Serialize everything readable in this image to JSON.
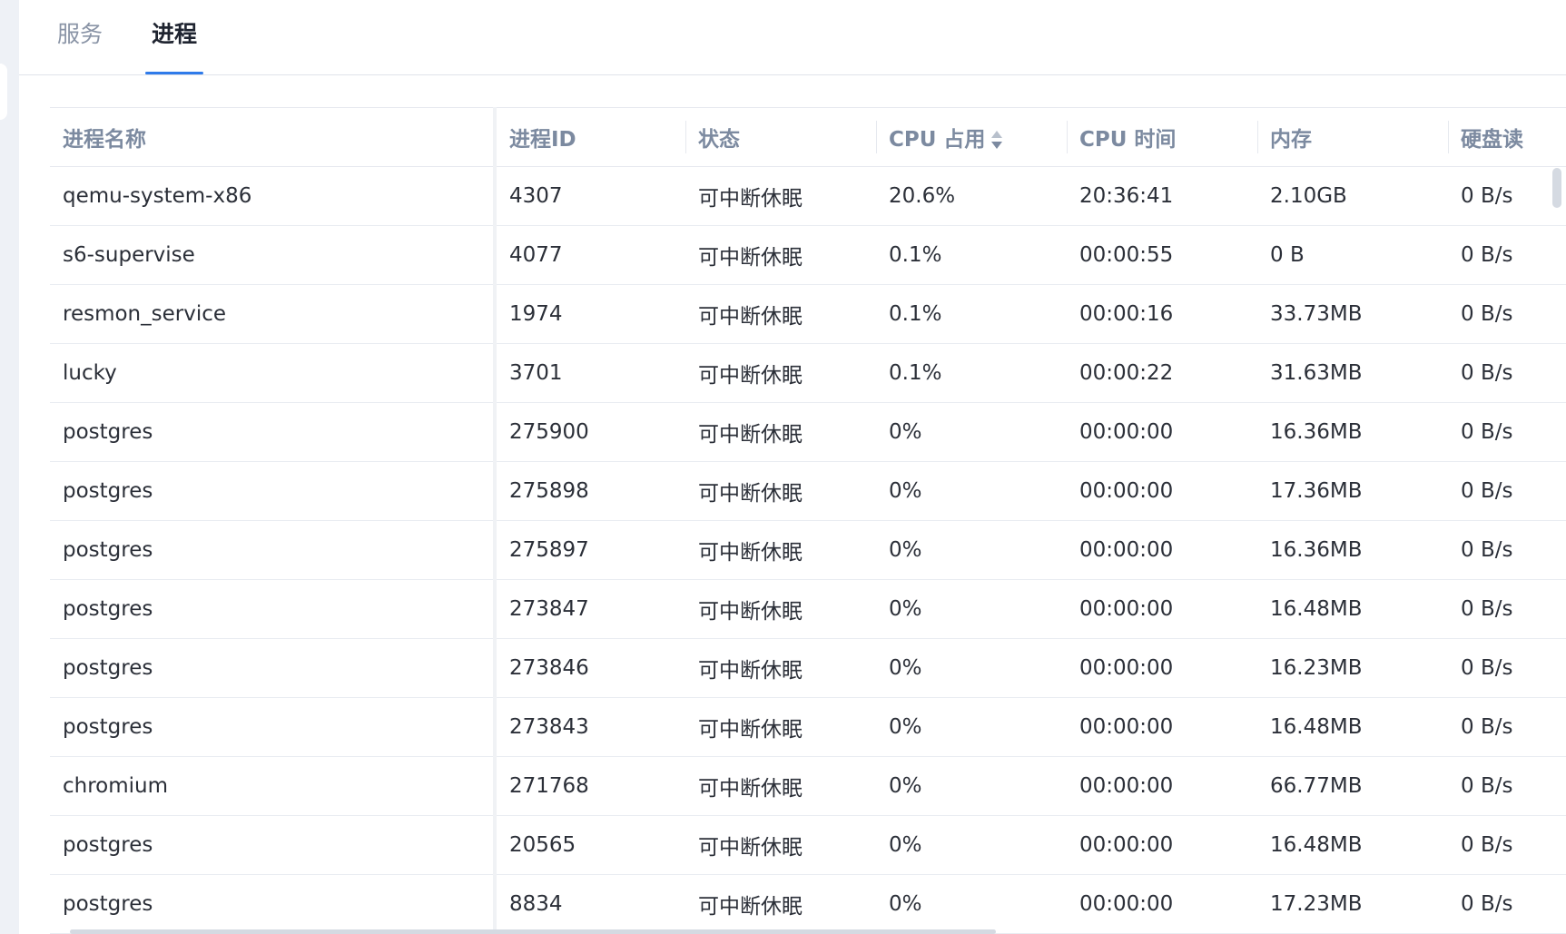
{
  "tabs": [
    {
      "label": "服务",
      "active": false
    },
    {
      "label": "进程",
      "active": true
    }
  ],
  "accent_color": "#2f7bea",
  "table": {
    "columns": [
      "进程名称",
      "进程ID",
      "状态",
      "CPU 占用",
      "CPU 时间",
      "内存",
      "硬盘读"
    ],
    "sorted_column": "CPU 占用",
    "sort_icon": "sort-updown-icon",
    "rows": [
      [
        "qemu-system-x86",
        "4307",
        "可中断休眠",
        "20.6%",
        "20:36:41",
        "2.10GB",
        "0 B/s"
      ],
      [
        "s6-supervise",
        "4077",
        "可中断休眠",
        "0.1%",
        "00:00:55",
        "0 B",
        "0 B/s"
      ],
      [
        "resmon_service",
        "1974",
        "可中断休眠",
        "0.1%",
        "00:00:16",
        "33.73MB",
        "0 B/s"
      ],
      [
        "lucky",
        "3701",
        "可中断休眠",
        "0.1%",
        "00:00:22",
        "31.63MB",
        "0 B/s"
      ],
      [
        "postgres",
        "275900",
        "可中断休眠",
        "0%",
        "00:00:00",
        "16.36MB",
        "0 B/s"
      ],
      [
        "postgres",
        "275898",
        "可中断休眠",
        "0%",
        "00:00:00",
        "17.36MB",
        "0 B/s"
      ],
      [
        "postgres",
        "275897",
        "可中断休眠",
        "0%",
        "00:00:00",
        "16.36MB",
        "0 B/s"
      ],
      [
        "postgres",
        "273847",
        "可中断休眠",
        "0%",
        "00:00:00",
        "16.48MB",
        "0 B/s"
      ],
      [
        "postgres",
        "273846",
        "可中断休眠",
        "0%",
        "00:00:00",
        "16.23MB",
        "0 B/s"
      ],
      [
        "postgres",
        "273843",
        "可中断休眠",
        "0%",
        "00:00:00",
        "16.48MB",
        "0 B/s"
      ],
      [
        "chromium",
        "271768",
        "可中断休眠",
        "0%",
        "00:00:00",
        "66.77MB",
        "0 B/s"
      ],
      [
        "postgres",
        "20565",
        "可中断休眠",
        "0%",
        "00:00:00",
        "16.48MB",
        "0 B/s"
      ],
      [
        "postgres",
        "8834",
        "可中断休眠",
        "0%",
        "00:00:00",
        "17.23MB",
        "0 B/s"
      ]
    ]
  }
}
